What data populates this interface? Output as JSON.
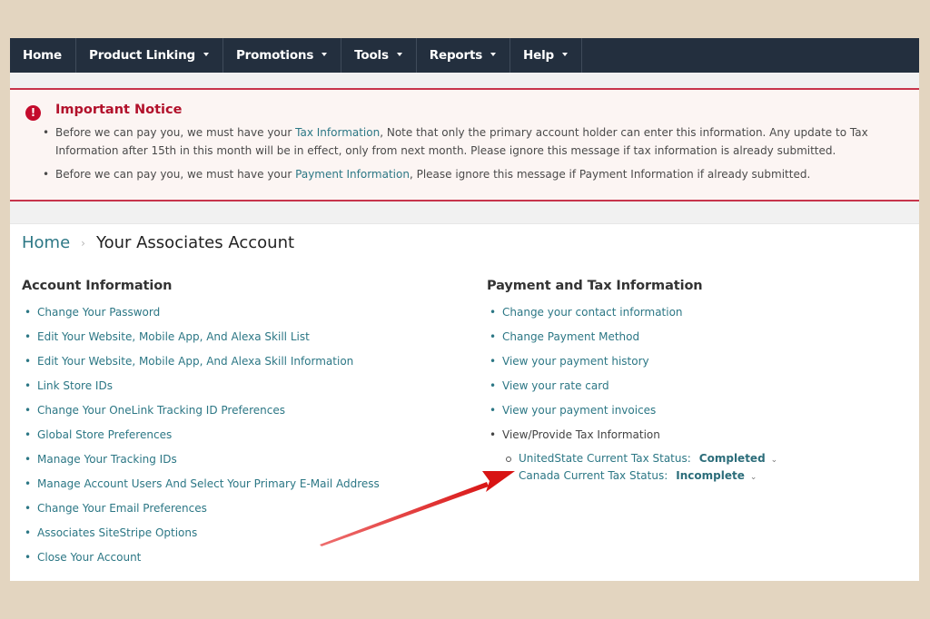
{
  "nav": {
    "items": [
      {
        "label": "Home",
        "dropdown": false
      },
      {
        "label": "Product Linking",
        "dropdown": true
      },
      {
        "label": "Promotions",
        "dropdown": true
      },
      {
        "label": "Tools",
        "dropdown": true
      },
      {
        "label": "Reports",
        "dropdown": true
      },
      {
        "label": "Help",
        "dropdown": true
      }
    ]
  },
  "notice": {
    "icon": "exclamation-circle-icon",
    "title": "Important Notice",
    "items": [
      {
        "before": "Before we can pay you, we must have your ",
        "link": "Tax Information",
        "after": ", Note that only the primary account holder can enter this information. Any update to Tax Information after 15th in this month will be in effect, only from next month. Please ignore this message if tax information is already submitted."
      },
      {
        "before": "Before we can pay you, we must have your ",
        "link": "Payment Information",
        "after": ", Please ignore this message if Payment Information if already submitted."
      }
    ]
  },
  "breadcrumb": {
    "home": "Home",
    "separator": "›",
    "current": "Your Associates Account"
  },
  "account_info": {
    "heading": "Account Information",
    "links": [
      "Change Your Password",
      "Edit Your Website, Mobile App, And Alexa Skill List",
      "Edit Your Website, Mobile App, And Alexa Skill Information",
      "Link Store IDs",
      "Change Your OneLink Tracking ID Preferences",
      "Global Store Preferences",
      "Manage Your Tracking IDs",
      "Manage Account Users And Select Your Primary E-Mail Address",
      "Change Your Email Preferences",
      "Associates SiteStripe Options",
      "Close Your Account"
    ]
  },
  "payment_tax": {
    "heading": "Payment and Tax Information",
    "links": [
      "Change your contact information",
      "Change Payment Method",
      "View your payment history",
      "View your rate card",
      "View your payment invoices"
    ],
    "tax_item": "View/Provide Tax Information",
    "tax_status": [
      {
        "label": "UnitedState Current Tax Status:",
        "status": "Completed"
      },
      {
        "label": "Canada Current Tax Status:",
        "status": "Incomplete"
      }
    ]
  },
  "annotation": {
    "type": "red-arrow",
    "color": "#e01818",
    "points_to": "Canada Current Tax Status"
  },
  "colors": {
    "nav_bg": "#232f3e",
    "link": "#2c7785",
    "notice_accent": "#c7344b",
    "notice_title": "#b2112b",
    "page_bg": "#e3d5c0"
  }
}
